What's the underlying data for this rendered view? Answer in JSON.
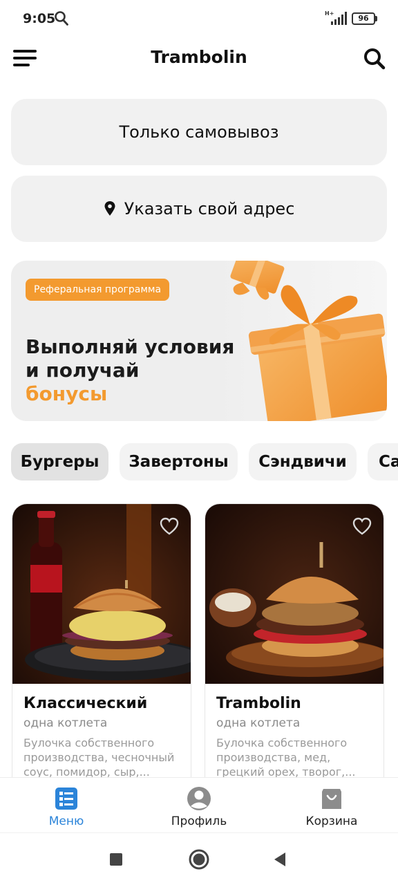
{
  "status_bar": {
    "time": "9:05",
    "network": "H+",
    "battery": "96"
  },
  "header": {
    "title": "Trambolin"
  },
  "delivery": {
    "pickup_label": "Только самовывоз",
    "address_label": "Указать свой адрес"
  },
  "banner": {
    "tag": "Реферальная программа",
    "title_line1": "Выполняй условия",
    "title_line2": "и получай",
    "title_accent": "бонусы",
    "accent_color": "#f39a2f"
  },
  "categories": [
    {
      "label": "Бургеры",
      "active": true
    },
    {
      "label": "Завертоны",
      "active": false
    },
    {
      "label": "Сэндвичи",
      "active": false
    },
    {
      "label": "Са",
      "active": false
    }
  ],
  "products": [
    {
      "name": "Классический",
      "subtitle": "одна котлета",
      "description": "Булочка собственного производства, чесночный соус, помидор, сыр,..."
    },
    {
      "name": "Trambolin",
      "subtitle": "одна котлета",
      "description": "Булочка собственного производства, мед, грецкий орех, творог,..."
    }
  ],
  "bottom_nav": [
    {
      "label": "Меню",
      "icon": "menu-list-icon",
      "active": true
    },
    {
      "label": "Профиль",
      "icon": "profile-icon",
      "active": false
    },
    {
      "label": "Корзина",
      "icon": "cart-icon",
      "active": false
    }
  ],
  "colors": {
    "active_nav": "#2b84d9",
    "card_bg": "#f1f1f1"
  }
}
